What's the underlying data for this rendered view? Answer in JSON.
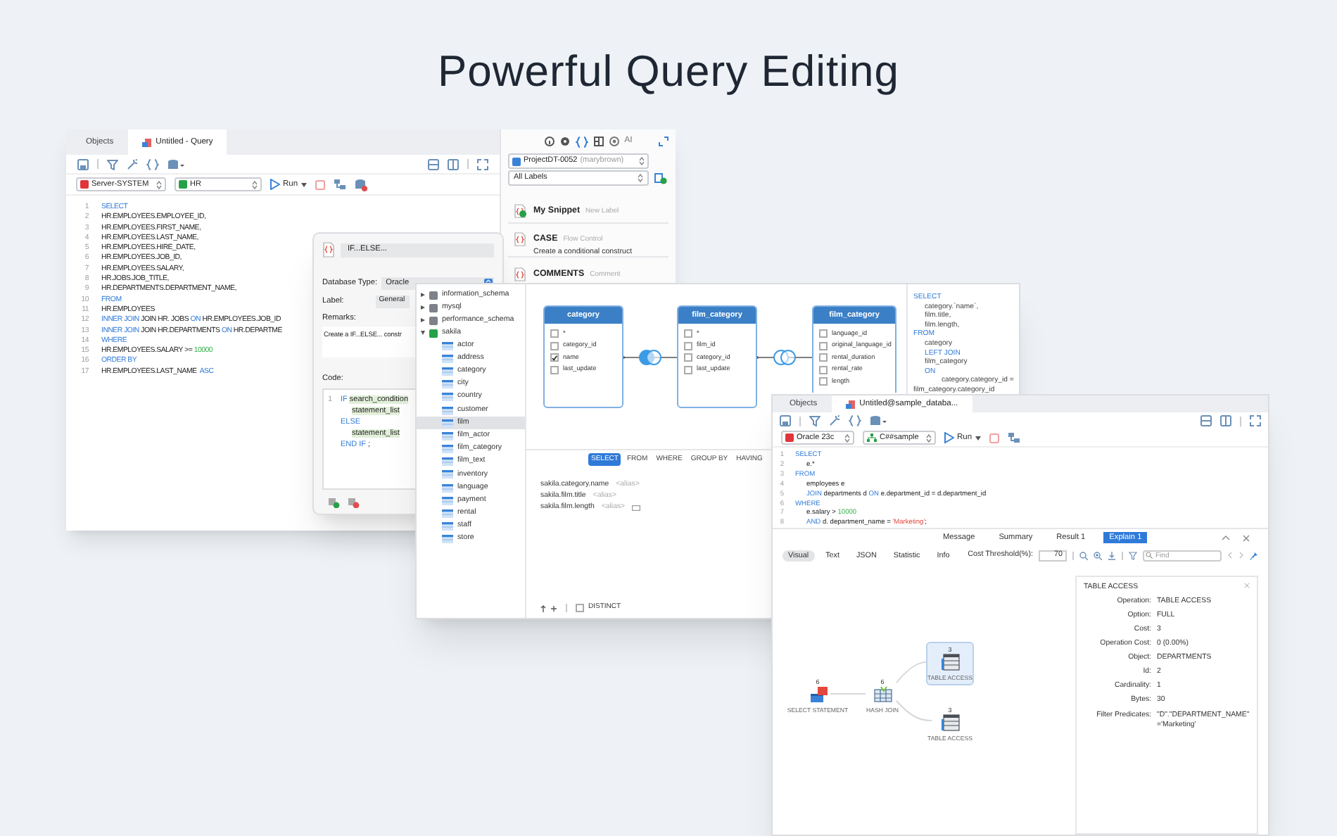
{
  "headline": "Powerful Query Editing",
  "query_window": {
    "tabs": [
      {
        "label": "Objects",
        "selected": false
      },
      {
        "label": "Untitled - Query",
        "selected": true
      }
    ],
    "connection": "Server-SYSTEM",
    "schema": "HR",
    "run": "Run",
    "code": [
      {
        "n": "1",
        "parts": [
          {
            "t": "SELECT",
            "kind": "kw"
          }
        ]
      },
      {
        "n": "2",
        "parts": [
          {
            "t": "HR.EMPLOYEES.EMPLOYEE_ID,"
          }
        ]
      },
      {
        "n": "3",
        "parts": [
          {
            "t": "HR.EMPLOYEES.FIRST_NAME,"
          }
        ]
      },
      {
        "n": "4",
        "parts": [
          {
            "t": "HR.EMPLOYEES.LAST_NAME,"
          }
        ]
      },
      {
        "n": "5",
        "parts": [
          {
            "t": "HR.EMPLOYEES.HIRE_DATE,"
          }
        ]
      },
      {
        "n": "6",
        "parts": [
          {
            "t": "HR.EMPLOYEES.JOB_ID,"
          }
        ]
      },
      {
        "n": "7",
        "parts": [
          {
            "t": "HR.EMPLOYEES.SALARY,"
          }
        ]
      },
      {
        "n": "8",
        "parts": [
          {
            "t": "HR.JOBS.JOB_TITLE,"
          }
        ]
      },
      {
        "n": "9",
        "parts": [
          {
            "t": "HR.DEPARTMENTS.DEPARTMENT_NAME,"
          }
        ]
      },
      {
        "n": "10",
        "parts": [
          {
            "t": "FROM",
            "kind": "kw"
          }
        ]
      },
      {
        "n": "11",
        "parts": [
          {
            "t": "HR.EMPLOYEES"
          }
        ]
      },
      {
        "n": "12",
        "parts": [
          {
            "t": "INNER JOIN",
            "kind": "kw"
          },
          {
            "t": " JOIN HR. JOBS "
          },
          {
            "t": "ON",
            "kind": "kw"
          },
          {
            "t": " HR.EMPLOYEES.JOB_ID"
          }
        ]
      },
      {
        "n": "13",
        "parts": [
          {
            "t": "INNER JOIN",
            "kind": "kw"
          },
          {
            "t": " JOIN HR.DEPARTMENTS "
          },
          {
            "t": "ON",
            "kind": "kw"
          },
          {
            "t": " HR.DEPARTME"
          }
        ]
      },
      {
        "n": "14",
        "parts": [
          {
            "t": "WHERE",
            "kind": "kw"
          }
        ]
      },
      {
        "n": "15",
        "parts": [
          {
            "t": "HR.EMPLOYEES.SALARY >= "
          },
          {
            "t": "10000",
            "kind": "num"
          }
        ]
      },
      {
        "n": "16",
        "parts": [
          {
            "t": "ORDER BY",
            "kind": "kw"
          }
        ]
      },
      {
        "n": "17",
        "parts": [
          {
            "t": "HR.EMPLOYEES.LAST_NAME  "
          },
          {
            "t": "ASC",
            "kind": "kw"
          }
        ]
      }
    ]
  },
  "snippet_panel": {
    "ai_button": "AI",
    "project": "ProjectDT-0052",
    "owner": "(marybrown)",
    "label_filter": "All Labels",
    "snippets": [
      {
        "name": "My Snippet",
        "label": "New Label",
        "kind": "own"
      },
      {
        "name": "CASE",
        "label": "Flow Control",
        "description": "Create a conditional construct",
        "kind": "shared"
      },
      {
        "name": "COMMENTS",
        "label": "Comment",
        "kind": "shared"
      }
    ]
  },
  "snippet_dialog": {
    "name": "IF...ELSE...",
    "database_type_label": "Database Type:",
    "database_type": "Oracle",
    "label_label": "Label:",
    "label": "General",
    "remarks_label": "Remarks:",
    "remarks": "Create a IF...ELSE... constr",
    "code_label": "Code:",
    "code": [
      {
        "n": "1",
        "parts": [
          {
            "t": "IF ",
            "kind": "kw"
          },
          {
            "t": "search_condition",
            "kind": "ph"
          }
        ]
      },
      {
        "kind": "indented",
        "parts": [
          {
            "t": "statement_list",
            "kind": "ph"
          }
        ]
      },
      {
        "parts": [
          {
            "t": "ELSE",
            "kind": "kw"
          }
        ]
      },
      {
        "kind": "indented",
        "parts": [
          {
            "t": "statement_list",
            "kind": "ph"
          }
        ]
      },
      {
        "parts": [
          {
            "t": "END IF",
            "kind": "kw"
          },
          {
            "t": " ;"
          }
        ]
      }
    ]
  },
  "query_builder": {
    "tree": [
      {
        "name": "information_schema",
        "expanded": false,
        "color": "#7d828a"
      },
      {
        "name": "mysql",
        "expanded": false,
        "color": "#7d828a"
      },
      {
        "name": "performance_schema",
        "expanded": false,
        "color": "#7d828a"
      },
      {
        "name": "sakila",
        "expanded": true,
        "color": "#26a148",
        "children": [
          {
            "name": "actor",
            "selected": false
          },
          {
            "name": "address",
            "selected": false
          },
          {
            "name": "category",
            "selected": false
          },
          {
            "name": "city",
            "selected": false
          },
          {
            "name": "country",
            "selected": false
          },
          {
            "name": "customer",
            "selected": false
          },
          {
            "name": "film",
            "selected": true
          },
          {
            "name": "film_actor",
            "selected": false
          },
          {
            "name": "film_category",
            "selected": false
          },
          {
            "name": "film_text",
            "selected": false
          },
          {
            "name": "inventory",
            "selected": false
          },
          {
            "name": "language",
            "selected": false
          },
          {
            "name": "payment",
            "selected": false
          },
          {
            "name": "rental",
            "selected": false
          },
          {
            "name": "staff",
            "selected": false
          },
          {
            "name": "store",
            "selected": false
          }
        ]
      }
    ],
    "tables": [
      {
        "title": "category",
        "fields": [
          {
            "name": "*",
            "checked": false
          },
          {
            "name": "category_id",
            "checked": false
          },
          {
            "name": "name",
            "checked": true
          },
          {
            "name": "last_update",
            "checked": false
          }
        ]
      },
      {
        "title": "film_category",
        "fields": [
          {
            "name": "*",
            "checked": false
          },
          {
            "name": "film_id",
            "checked": false
          },
          {
            "name": "category_id",
            "checked": false
          },
          {
            "name": "last_update",
            "checked": false
          }
        ]
      },
      {
        "title": "film_category",
        "fields": [
          {
            "name": "language_id",
            "checked": false
          },
          {
            "name": "original_language_id",
            "checked": false
          },
          {
            "name": "rental_duration",
            "checked": false
          },
          {
            "name": "rental_rate",
            "checked": false
          },
          {
            "name": "length",
            "checked": false
          }
        ]
      }
    ],
    "joins": [
      {
        "kind": "left"
      },
      {
        "kind": "plain"
      }
    ],
    "sql": [
      {
        "parts": [
          {
            "t": "SELECT",
            "kind": "kw"
          }
        ]
      },
      {
        "kind": "indented",
        "parts": [
          {
            "t": "category.`name`,"
          }
        ]
      },
      {
        "kind": "indented",
        "parts": [
          {
            "t": "film.title,"
          }
        ]
      },
      {
        "kind": "indented",
        "parts": [
          {
            "t": "film.length,"
          }
        ]
      },
      {
        "parts": [
          {
            "t": "FROM",
            "kind": "kw"
          }
        ]
      },
      {
        "kind": "indented",
        "parts": [
          {
            "t": "category"
          }
        ]
      },
      {
        "kind": "indented",
        "parts": [
          {
            "t": "LEFT JOIN",
            "kind": "kw"
          }
        ]
      },
      {
        "kind": "indented",
        "parts": [
          {
            "t": "film_category"
          }
        ]
      },
      {
        "kind": "indented",
        "parts": [
          {
            "t": "ON",
            "kind": "kw"
          }
        ]
      },
      {
        "kind": "nested",
        "parts": [
          {
            "t": "category.category_id ="
          }
        ]
      },
      {
        "parts": [
          {
            "t": "film_category.category_id"
          }
        ]
      }
    ],
    "clause_tabs": [
      {
        "label": "SELECT",
        "selected": true
      },
      {
        "label": "FROM",
        "selected": false
      },
      {
        "label": "WHERE",
        "selected": false
      },
      {
        "label": "GROUP BY",
        "selected": false
      },
      {
        "label": "HAVING",
        "selected": false
      }
    ],
    "columns": [
      {
        "name": "sakila.category.name",
        "alias": "<alias>"
      },
      {
        "name": "sakila.film.title",
        "alias": "<alias>"
      },
      {
        "name": "sakila.film.length",
        "alias": "<alias>",
        "kind": "edit"
      }
    ],
    "distinct": {
      "label": "DISTINCT",
      "checked": false
    }
  },
  "explain_window": {
    "tabs": [
      {
        "label": "Objects",
        "selected": false
      },
      {
        "label": "Untitled@sample_databa...",
        "selected": true
      }
    ],
    "connection": "Oracle 23c",
    "schema": "C##sample",
    "run": "Run",
    "code": [
      {
        "n": "1",
        "parts": [
          {
            "t": "SELECT",
            "kind": "kw"
          }
        ]
      },
      {
        "n": "2",
        "kind": "indented",
        "parts": [
          {
            "t": "e.*"
          }
        ]
      },
      {
        "n": "3",
        "parts": [
          {
            "t": "FROM",
            "kind": "kw"
          }
        ]
      },
      {
        "n": "4",
        "kind": "indented",
        "parts": [
          {
            "t": "employees e"
          }
        ]
      },
      {
        "n": "5",
        "kind": "indented",
        "parts": [
          {
            "t": "JOIN",
            "kind": "kw"
          },
          {
            "t": " departments d "
          },
          {
            "t": "ON",
            "kind": "kw"
          },
          {
            "t": " e.department_id = d.department_id"
          }
        ]
      },
      {
        "n": "6",
        "parts": [
          {
            "t": "WHERE",
            "kind": "kw"
          }
        ]
      },
      {
        "n": "7",
        "kind": "indented",
        "parts": [
          {
            "t": "e.salary > "
          },
          {
            "t": "10000",
            "kind": "num"
          }
        ]
      },
      {
        "n": "8",
        "kind": "indented",
        "parts": [
          {
            "t": "AND",
            "kind": "kw"
          },
          {
            "t": " d. department_name = "
          },
          {
            "t": "'Marketing'",
            "kind": "str"
          },
          {
            "t": ";"
          }
        ]
      }
    ],
    "result_tabs": [
      {
        "label": "Message",
        "selected": false
      },
      {
        "label": "Summary",
        "selected": false
      },
      {
        "label": "Result 1",
        "selected": false
      },
      {
        "label": "Explain 1",
        "selected": true
      }
    ],
    "view_tabs": [
      {
        "label": "Visual",
        "selected": true
      },
      {
        "label": "Text",
        "selected": false
      },
      {
        "label": "JSON",
        "selected": false
      },
      {
        "label": "Statistic",
        "selected": false
      },
      {
        "label": "Info",
        "selected": false
      }
    ],
    "cost_threshold_label": "Cost Threshold(%):",
    "cost_threshold": "70",
    "find_placeholder": "Find",
    "plan": [
      {
        "kind": "select",
        "cost": "6",
        "label": "SELECT STATEMENT",
        "selected": false
      },
      {
        "kind": "join",
        "cost": "6",
        "label": "HASH JOIN",
        "selected": false
      },
      {
        "kind": "table",
        "cost": "3",
        "label": "TABLE ACCESS",
        "selected": true
      },
      {
        "kind": "table",
        "cost": "3",
        "label": "TABLE ACCESS",
        "selected": false
      }
    ],
    "details": {
      "title": "TABLE ACCESS",
      "rows": [
        {
          "key": "Operation:",
          "value": "TABLE ACCESS"
        },
        {
          "key": "Option:",
          "value": "FULL"
        },
        {
          "key": "Cost:",
          "value": "3"
        },
        {
          "key": "Operation Cost:",
          "value": "0 (0.00%)"
        },
        {
          "key": "Object:",
          "value": "DEPARTMENTS"
        },
        {
          "key": "Id:",
          "value": "2"
        },
        {
          "key": "Cardinality:",
          "value": "1"
        },
        {
          "key": "Bytes:",
          "value": "30"
        },
        {
          "key": "Filter Predicates:",
          "value": "\"D\".\"DEPARTMENT_NAME\" ='Marketing'"
        }
      ]
    }
  }
}
